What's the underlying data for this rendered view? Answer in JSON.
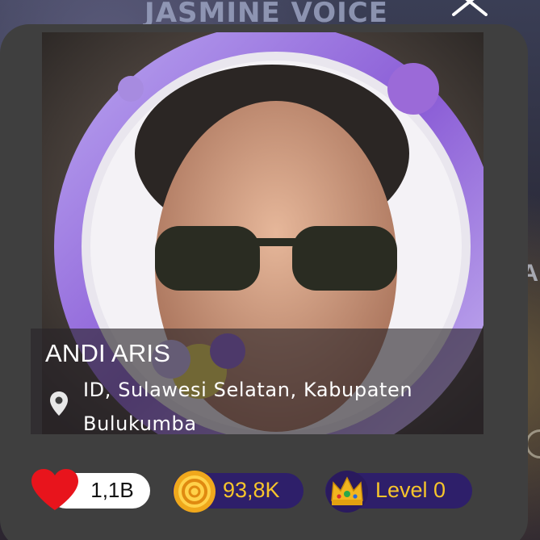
{
  "background": {
    "title": "JASMINE VOICE",
    "side_letter": "A"
  },
  "profile": {
    "name": "ANDI ARIS",
    "location": "ID, Sulawesi Selatan, Kabupaten Bulukumba"
  },
  "stats": {
    "likes": "1,1B",
    "coins": "93,8K",
    "level": "Level 0"
  },
  "icons": {
    "close": "close-icon",
    "location": "location-pin-icon",
    "likes": "heart-icon",
    "coins": "coin-icon",
    "level": "crown-icon"
  },
  "colors": {
    "card": "#3f3f3f",
    "stat_pill": "#2e1f6a",
    "stat_text": "#f7c52b",
    "heart": "#e8141c",
    "frame_ring": "#9b6ad8"
  }
}
